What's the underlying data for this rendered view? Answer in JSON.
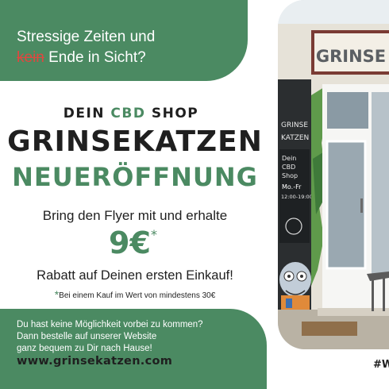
{
  "top": {
    "line1": "Stressige Zeiten und",
    "strike_word": "kein",
    "line2_rest": " Ende in Sicht?"
  },
  "headline": {
    "dein": "DEIN ",
    "cbd": "CBD",
    "shop": " SHOP",
    "brand": "GRINSEKATZEN",
    "neu": "NEUERÖFFNUNG"
  },
  "offer": {
    "bring": "Bring den Flyer mit und erhalte",
    "price": "9€",
    "price_mark": "*",
    "rabatt": "Rabatt auf Deinen ersten Einkauf!",
    "footnote_mark": "*",
    "footnote": "Bei einem Kauf im Wert von mindestens 30€"
  },
  "bottom": {
    "line1": "Du hast keine Möglichkeit vorbei zu kommen?",
    "line2": "Dann bestelle auf unserer Website",
    "line3": "ganz bequem zu Dir nach Hause!",
    "url": "www.grinsekatzen.com"
  },
  "photo": {
    "sign": "GRINSE",
    "side_sign_1": "GRINSE",
    "side_sign_2": "KATZEN",
    "board_1": "Dein",
    "board_2": "CBD",
    "board_3": "Shop",
    "board_4": "Mo.-Fr",
    "board_5": "12:00-19:00"
  },
  "hashtag": "#W",
  "colors": {
    "green": "#4b8a62",
    "strike": "#e0473f",
    "text": "#1f1f1f"
  }
}
